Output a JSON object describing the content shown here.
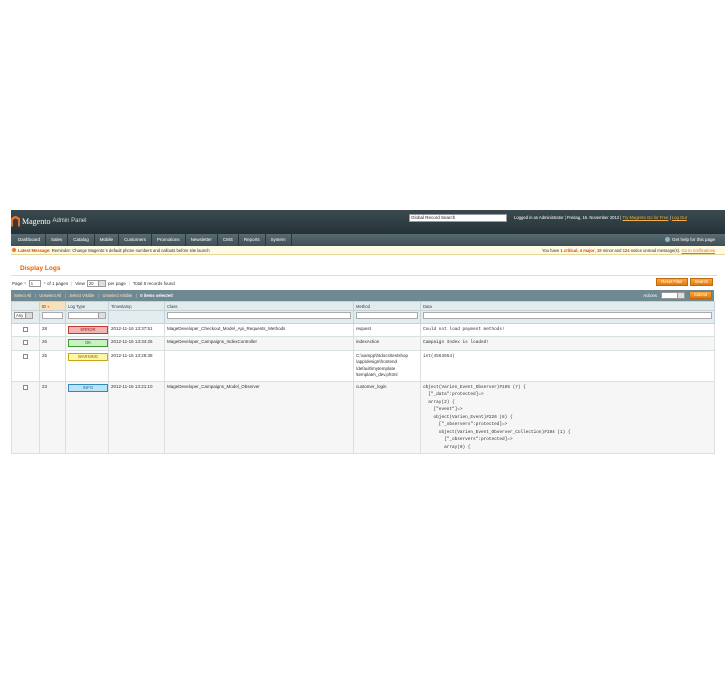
{
  "header": {
    "logo_text": "Magento",
    "logo_sub": "Admin Panel",
    "search_value": "Global Record Search",
    "logged_in": "Logged in as Administrator | Freitag, 16. November 2012 | ",
    "try_link": "Try Magento Go for Free",
    "logout": "Log Out"
  },
  "nav": {
    "items": [
      "Dashboard",
      "Sales",
      "Catalog",
      "Mobile",
      "Customers",
      "Promotions",
      "Newsletter",
      "CMS",
      "Reports",
      "System"
    ],
    "help": "Get help for this page"
  },
  "messages": {
    "label": "Latest Message:",
    "text": "Reminder: Change Magento`s default phone numbers and callouts before site launch",
    "summary_prefix": "You have ",
    "critical": "1 critical",
    "major": "4 major",
    "minor": "19",
    "notice": "124",
    "summary_mid1": ", ",
    "summary_mid2": ", ",
    "summary_mid3": " minor and ",
    "summary_suffix": " notice unread message(s). ",
    "goto": "Go to notifications"
  },
  "page": {
    "title": "Display Logs"
  },
  "pager": {
    "page_label": "Page",
    "page_value": "1",
    "of_pages": "of 1 pages",
    "view_label": "View",
    "view_value": "20",
    "per_page": "per page",
    "total": "Total 8 records found",
    "reset_filter": "Reset Filter",
    "search": "Search"
  },
  "massaction": {
    "select_all": "Select All",
    "unselect_all": "Unselect All",
    "select_visible": "Select Visible",
    "unselect_visible": "Unselect Visible",
    "items_selected": "0 items selected",
    "actions_label": "Actions",
    "submit": "Submit"
  },
  "grid": {
    "columns": [
      "",
      "ID",
      "Log Type",
      "Timestamp",
      "Class",
      "Method",
      "Data"
    ],
    "filter_any": "Any",
    "rows": [
      {
        "id": "28",
        "type": "ERROR",
        "type_class": "error",
        "timestamp": "2012-11-16 13:37:51",
        "class": "MageDeveloper_Checkout_Model_Api_Requests_Methods",
        "method": "request",
        "data": "Could not load payment methods!"
      },
      {
        "id": "26",
        "type": "OK",
        "type_class": "ok",
        "timestamp": "2012-11-16 13:34:25",
        "class": "MageDeveloper_Campaigns_IndexController",
        "method": "indexAction",
        "data": "Campaign Index is loaded!"
      },
      {
        "id": "25",
        "type": "WARNING",
        "type_class": "warning",
        "timestamp": "2012-11-16 13:29:38",
        "class": "",
        "method": "C:\\xampp\\htdocs\\testshop\n\\app\\design\\frontend\n\\default\\mytemplate\n\\template\\_dev.phtml",
        "data": "int(4563654)"
      },
      {
        "id": "23",
        "type": "INFO",
        "type_class": "info",
        "timestamp": "2012-11-16 13:21:10",
        "class": "MageDeveloper_Campaigns_Model_Observer",
        "method": "customer_login",
        "data": "object(Varien_Event_Observer)#195 (7) {\n  [\"_data\":protected]=>\n  array(2) {\n    [\"event\"]=>\n    object(Varien_Event)#226 (8) {\n      [\"_observers\":protected]=>\n      object(Varien_Event_Observer_Collection)#194 (1) {\n        [\"_observers\":protected]=>\n        array(0) {"
      }
    ]
  },
  "colors": {
    "accent": "#eb5e00",
    "header_bg": "#2b3a40",
    "massaction_bg": "#6f8992"
  }
}
